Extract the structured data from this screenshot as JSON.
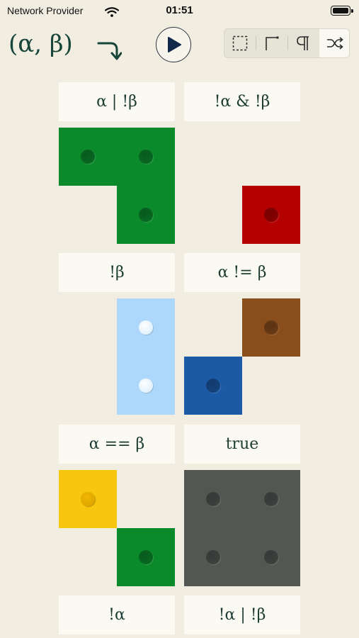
{
  "status_bar": {
    "carrier": "Network Provider",
    "time": "01:51"
  },
  "header": {
    "title": "(α, β)",
    "return_icon": "curved-return-arrow-icon",
    "play_icon": "play-icon",
    "tools": [
      {
        "icon": "selection-icon",
        "active": false
      },
      {
        "icon": "corner-icon",
        "active": false
      },
      {
        "icon": "pilcrow-icon",
        "active": false
      },
      {
        "icon": "shuffle-icon",
        "active": true
      }
    ]
  },
  "colors": {
    "background": "#F1EEE1",
    "green": "#0B8A2C",
    "red": "#B50000",
    "light_blue": "#AED8FB",
    "brown": "#8A4D1C",
    "blue": "#1C5AA6",
    "yellow": "#F8C50F",
    "dark_gray": "#525753"
  },
  "puzzles": {
    "p1": {
      "expression": "α | !β"
    },
    "p2": {
      "expression": "!α & !β"
    },
    "p3": {
      "expression": "!β"
    },
    "p4": {
      "expression": "α != β"
    },
    "p5": {
      "expression": "α == β"
    },
    "p6": {
      "expression": "true"
    },
    "p7": {
      "expression": "!α"
    },
    "p8": {
      "expression": "!α | !β"
    }
  }
}
